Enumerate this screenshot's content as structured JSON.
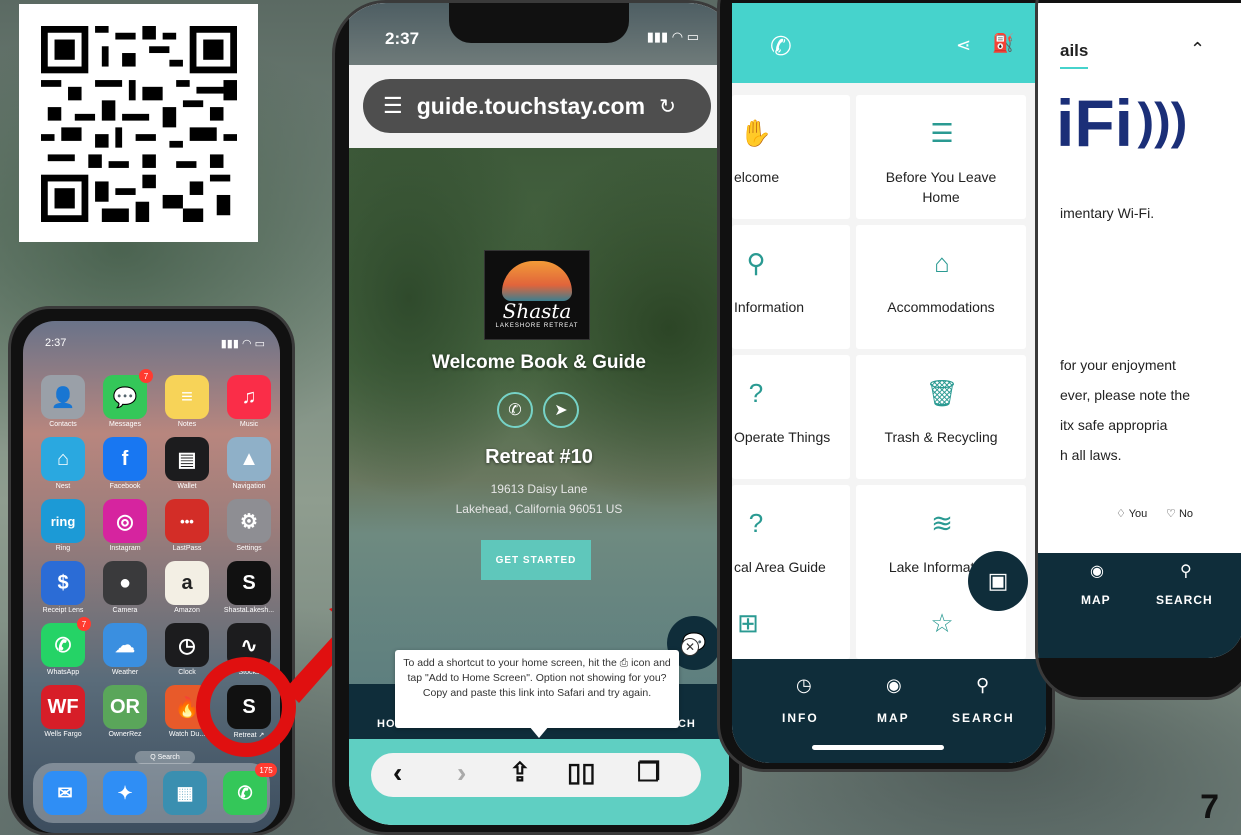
{
  "page_number": "7",
  "home_screen": {
    "time": "2:37",
    "apps": [
      {
        "label": "Contacts",
        "color": "#9aa0a8",
        "glyph": "👤"
      },
      {
        "label": "Messages",
        "color": "#34c759",
        "glyph": "💬",
        "badge": "7"
      },
      {
        "label": "Notes",
        "color": "#f7d358",
        "glyph": "≡"
      },
      {
        "label": "Music",
        "color": "#fa2d48",
        "glyph": "♫"
      },
      {
        "label": "Nest",
        "color": "#2aa8e0",
        "glyph": "⌂"
      },
      {
        "label": "Facebook",
        "color": "#1877f2",
        "glyph": "f"
      },
      {
        "label": "Wallet",
        "color": "#1c1c1e",
        "glyph": "▤"
      },
      {
        "label": "Navigation",
        "color": "#8fb0c8",
        "glyph": "▲"
      },
      {
        "label": "Ring",
        "color": "#1c9ad6",
        "glyph": "ring"
      },
      {
        "label": "Instagram",
        "color": "#d6249f",
        "glyph": "◎"
      },
      {
        "label": "LastPass",
        "color": "#d32d27",
        "glyph": "•••"
      },
      {
        "label": "Settings",
        "color": "#8e8e93",
        "glyph": "⚙"
      },
      {
        "label": "Receipt Lens",
        "color": "#2b6cd6",
        "glyph": "$"
      },
      {
        "label": "Camera",
        "color": "#3a3a3c",
        "glyph": "●"
      },
      {
        "label": "Amazon",
        "color": "#f3efe4",
        "glyph": "a"
      },
      {
        "label": "ShastaLakesh...",
        "color": "#111111",
        "glyph": "S"
      },
      {
        "label": "WhatsApp",
        "color": "#25d366",
        "glyph": "✆",
        "badge": "7"
      },
      {
        "label": "Weather",
        "color": "#3a8fe0",
        "glyph": "☁"
      },
      {
        "label": "Clock",
        "color": "#1c1c1e",
        "glyph": "◷"
      },
      {
        "label": "Stocks",
        "color": "#1c1c1e",
        "glyph": "∿"
      },
      {
        "label": "Wells Fargo",
        "color": "#d71e28",
        "glyph": "WF"
      },
      {
        "label": "OwnerRez",
        "color": "#5aa65a",
        "glyph": "OR"
      },
      {
        "label": "Watch Du...",
        "color": "#e85a2a",
        "glyph": "🔥"
      },
      {
        "label": "Retreat ↗",
        "color": "#111111",
        "glyph": "S"
      }
    ],
    "search_label": "Q Search",
    "dock": [
      {
        "name": "mail",
        "color": "#2f8ef5",
        "glyph": "✉"
      },
      {
        "name": "safari",
        "color": "#2f8ef5",
        "glyph": "✦"
      },
      {
        "name": "news",
        "color": "#3a8fb0",
        "glyph": "▦"
      },
      {
        "name": "phone",
        "color": "#34c759",
        "glyph": "✆",
        "badge": "175"
      }
    ]
  },
  "safari": {
    "time": "2:37",
    "url": "guide.touchstay.com",
    "logo_word": "Shasta",
    "logo_sub": "LAKESHORE RETREAT",
    "hero_title": "Welcome Book & Guide",
    "property_name": "Retreat #10",
    "address_line1": "19613 Daisy Lane",
    "address_line2": "Lakehead, California 96051 US",
    "get_started": "GET STARTED",
    "tooltip": "To add a shortcut to your home screen, hit the ⎙ icon and tap \"Add to Home Screen\". Option not showing for you? Copy and paste this link into Safari and try again.",
    "nav_left": "HO",
    "nav_right": "RCH"
  },
  "guide_menu": {
    "tiles": [
      {
        "label": "Welcome",
        "shown": "elcome",
        "icon": "✋"
      },
      {
        "label": "Before You Leave Home",
        "shown": "Before You Leave\nHome",
        "icon": "☰"
      },
      {
        "label": "Information",
        "shown": "Information",
        "icon": "⚲"
      },
      {
        "label": "Accommodations",
        "shown": "Accommodations",
        "icon": "⌂"
      },
      {
        "label": "Operate Things",
        "shown": "Operate Things",
        "icon": "?"
      },
      {
        "label": "Trash & Recycling",
        "shown": "Trash & Recycling",
        "icon": "🗑"
      },
      {
        "label": "Local Area Guide",
        "shown": "cal Area Guide",
        "icon": "?"
      },
      {
        "label": "Lake Information",
        "shown": "Lake Information",
        "icon": "≋"
      }
    ],
    "nav": [
      {
        "label": "INFO",
        "icon": "◷"
      },
      {
        "label": "MAP",
        "icon": "◉"
      },
      {
        "label": "SEARCH",
        "icon": "⚲"
      }
    ]
  },
  "wifi_detail": {
    "section_title": "ails",
    "wifi_text": "iFi",
    "intro": "imentary Wi-Fi.",
    "body_lines": [
      "for your enjoyment",
      "ever, please note the",
      "itx safe appropria",
      "h all laws."
    ],
    "feedback_you": "You",
    "feedback_no": "No",
    "nav": [
      {
        "label": "MAP",
        "icon": "◉"
      },
      {
        "label": "SEARCH",
        "icon": "⚲"
      }
    ]
  }
}
